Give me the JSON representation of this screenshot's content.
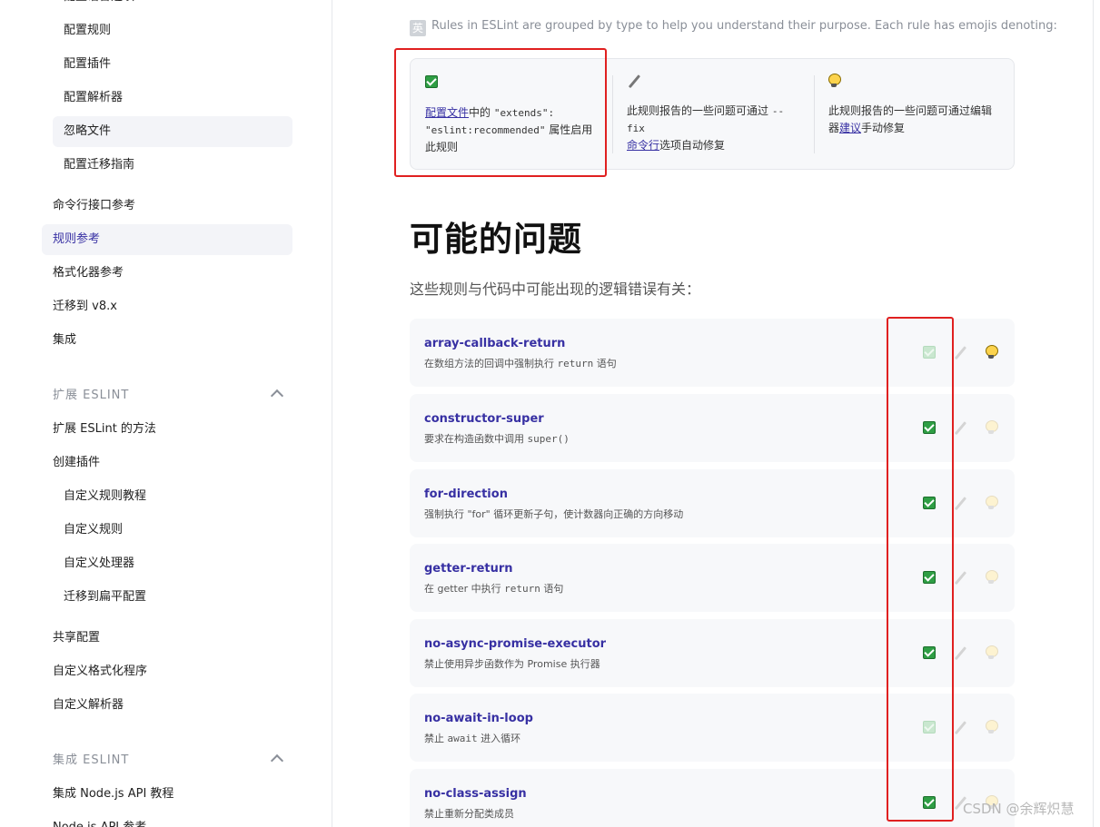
{
  "sidebar": {
    "cutoff_item": "配置语言选项",
    "config_items": [
      "配置规则",
      "配置插件",
      "配置解析器",
      "忽略文件",
      "配置迁移指南"
    ],
    "use_items": [
      "命令行接口参考",
      "规则参考",
      "格式化器参考",
      "迁移到 v8.x",
      "集成"
    ],
    "section_extend": "扩展 ESLINT",
    "extend_items": [
      "扩展 ESLint 的方法",
      "创建插件"
    ],
    "plugin_items": [
      "自定义规则教程",
      "自定义规则",
      "自定义处理器",
      "迁移到扁平配置"
    ],
    "extend_items_2": [
      "共享配置",
      "自定义格式化程序",
      "自定义解析器"
    ],
    "section_integrate": "集成 ESLINT",
    "integrate_items": [
      "集成 Node.js API 教程",
      "Node.js API 参考"
    ]
  },
  "intro": {
    "badge": "英",
    "text": "Rules in ESLint are grouped by type to help you understand their purpose. Each rule has emojis denoting:"
  },
  "legend": {
    "recommended": {
      "link": "配置文件",
      "t1": "中的",
      "code1": "\"extends\":",
      "code2": "\"eslint:recommended\"",
      "t2": "属性启用此规则"
    },
    "fixable": {
      "t1": "此规则报告的一些问题可通过",
      "code": "--fix",
      "link": "命令行",
      "t2": "选项自动修复"
    },
    "suggestion": {
      "t1": "此规则报告的一些问题可通过编辑器",
      "link": "建议",
      "t2": "手动修复"
    }
  },
  "section": {
    "title": "可能的问题",
    "lead": "这些规则与代码中可能出现的逻辑错误有关："
  },
  "rules": [
    {
      "name": "array-callback-return",
      "pre": "在数组方法的回调中强制执行",
      "code": "return",
      "post": "语句"
    },
    {
      "name": "constructor-super",
      "pre": "要求在构造函数中调用",
      "code": "super()",
      "post": ""
    },
    {
      "name": "for-direction",
      "pre": "强制执行 \"for\" 循环更新子句，使计数器向正确的方向移动",
      "code": "",
      "post": ""
    },
    {
      "name": "getter-return",
      "pre": "在 getter 中执行",
      "code": "return",
      "post": "语句"
    },
    {
      "name": "no-async-promise-executor",
      "pre": "禁止使用异步函数作为 Promise 执行器",
      "code": "",
      "post": ""
    },
    {
      "name": "no-await-in-loop",
      "pre": "禁止",
      "code": "await",
      "post": "进入循环"
    },
    {
      "name": "no-class-assign",
      "pre": "禁止重新分配类成员",
      "code": "",
      "post": ""
    }
  ],
  "watermark": "CSDN @余辉炽慧",
  "colors": {
    "link": "#3730a3",
    "check": "#2f9e44",
    "annotation": "#e02020"
  }
}
